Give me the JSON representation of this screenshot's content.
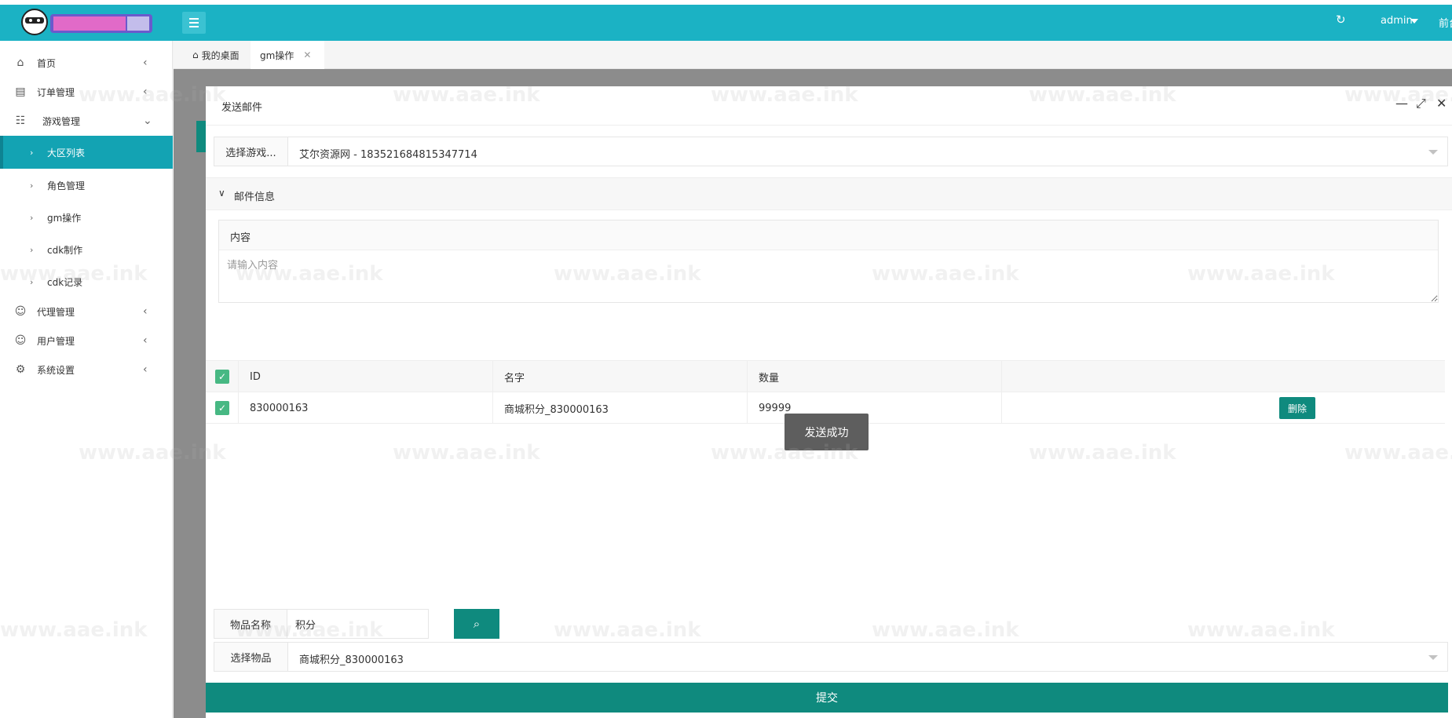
{
  "header": {
    "refresh_icon": "refresh-icon",
    "user": "admin",
    "front_link": "前台"
  },
  "sidebar": {
    "items": [
      {
        "label": "首页",
        "icon": "home-icon"
      },
      {
        "label": "订单管理",
        "icon": "order-icon"
      },
      {
        "label": "游戏管理",
        "icon": "sitemap-icon"
      },
      {
        "label": "大区列表"
      },
      {
        "label": "角色管理"
      },
      {
        "label": "gm操作"
      },
      {
        "label": "cdk制作"
      },
      {
        "label": "cdk记录"
      },
      {
        "label": "代理管理",
        "icon": "agent-icon"
      },
      {
        "label": "用户管理",
        "icon": "user-icon"
      },
      {
        "label": "系统设置",
        "icon": "gear-icon"
      }
    ]
  },
  "tabs": [
    {
      "label": "我的桌面"
    },
    {
      "label": "gm操作"
    }
  ],
  "watermark": "www.aae.ink",
  "dialog": {
    "title": "发送邮件",
    "game_label": "选择游戏...",
    "game_value": "艾尔资源网 - 183521684815347714",
    "section_title": "邮件信息",
    "content_label": "内容",
    "content_placeholder": "请输入内容",
    "table": {
      "headers": [
        "ID",
        "名字",
        "数量"
      ],
      "rows": [
        {
          "id": "830000163",
          "name": "商城积分_830000163",
          "qty": "99999",
          "action": "删除"
        }
      ]
    },
    "toast": "发送成功",
    "search_label": "物品名称",
    "search_value": "积分",
    "item_label": "选择物品",
    "item_value": "商城积分_830000163",
    "submit_label": "提交"
  },
  "colors": {
    "header": "#1bb2c4",
    "active_nav": "#13a3b3",
    "primary_button": "#0f8a7e",
    "checkbox": "#47b883"
  }
}
